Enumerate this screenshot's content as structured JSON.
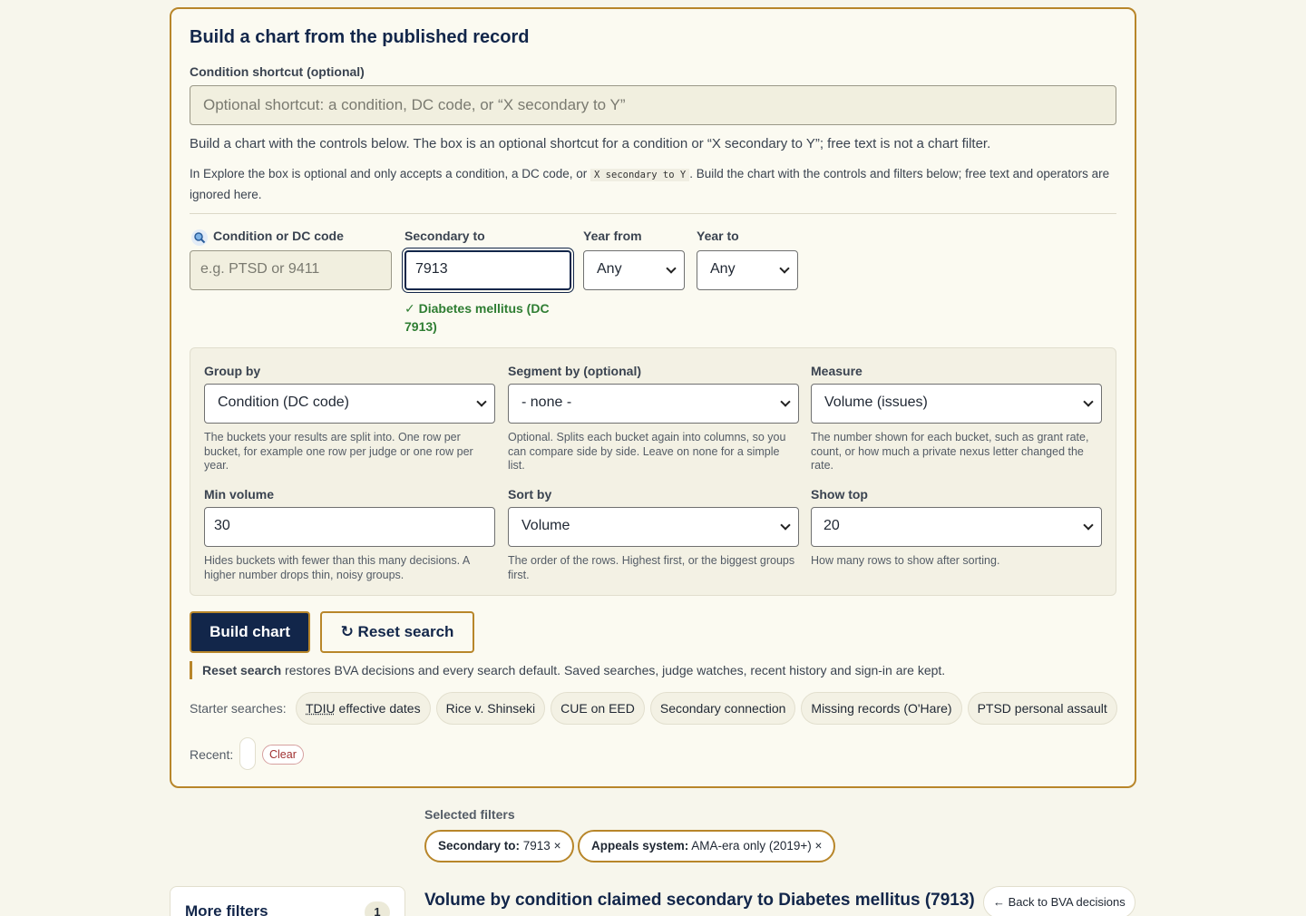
{
  "builder": {
    "title": "Build a chart from the published record",
    "shortcut_label": "Condition shortcut (optional)",
    "shortcut_placeholder": "Optional shortcut: a condition, DC code, or “X secondary to Y”",
    "desc_main": "Build a chart with the controls below. The box is an optional shortcut for a condition or “X secondary to Y”; free text is not a chart filter.",
    "desc_explore_before": "In Explore the box is optional and only accepts a condition, a DC code, or",
    "desc_explore_code": "X secondary to Y",
    "desc_explore_after": ". Build the chart with the controls and filters below; free text and operators are ignored here."
  },
  "filters_row": {
    "condition_label": "Condition or DC code",
    "condition_placeholder": "e.g. PTSD or 9411",
    "secondary_label": "Secondary to",
    "secondary_value": "7913",
    "secondary_match": "Diabetes mellitus (DC 7913)",
    "year_from_label": "Year from",
    "year_from_value": "Any",
    "year_to_label": "Year to",
    "year_to_value": "Any"
  },
  "panel": {
    "group_by": {
      "label": "Group by",
      "value": "Condition (DC code)",
      "help": "The buckets your results are split into. One row per bucket, for example one row per judge or one row per year."
    },
    "segment_by": {
      "label": "Segment by (optional)",
      "value": "- none -",
      "help": "Optional. Splits each bucket again into columns, so you can compare side by side. Leave on none for a simple list."
    },
    "measure": {
      "label": "Measure",
      "value": "Volume (issues)",
      "help": "The number shown for each bucket, such as grant rate, count, or how much a private nexus letter changed the rate."
    },
    "min_volume": {
      "label": "Min volume",
      "value": "30",
      "help": "Hides buckets with fewer than this many decisions. A higher number drops thin, noisy groups."
    },
    "sort_by": {
      "label": "Sort by",
      "value": "Volume",
      "help": "The order of the rows. Highest first, or the biggest groups first."
    },
    "show_top": {
      "label": "Show top",
      "value": "20",
      "help": "How many rows to show after sorting."
    }
  },
  "actions": {
    "build_label": "Build chart",
    "reset_label": "↻ Reset search",
    "reset_note_bold": "Reset search",
    "reset_note_rest": " restores BVA decisions and every search default. Saved searches, judge watches, recent history and sign-in are kept."
  },
  "starters": {
    "label": "Starter searches:",
    "tdiu_abbr": "TDIU",
    "tdiu_rest": " effective dates",
    "items": [
      "Rice v. Shinseki",
      "CUE on EED",
      "Secondary connection",
      "Missing records (O'Hare)",
      "PTSD personal assault"
    ]
  },
  "recent": {
    "label": "Recent:",
    "clear_label": "Clear"
  },
  "selected_filters": {
    "label": "Selected filters",
    "pills": [
      {
        "key": "Secondary to:",
        "value": " 7913 ×"
      },
      {
        "key": "Appeals system:",
        "value": " AMA-era only (2019+) ×"
      }
    ]
  },
  "more_filters": {
    "title": "More filters",
    "count": "1"
  },
  "result": {
    "title": "Volume by condition claimed secondary to Diabetes mellitus (7913)",
    "back_label": "← Back to BVA decisions"
  },
  "colors": {
    "accent": "#b8862a",
    "navy": "#12264a",
    "success": "#2e7d32",
    "background": "#f7f6ec"
  }
}
